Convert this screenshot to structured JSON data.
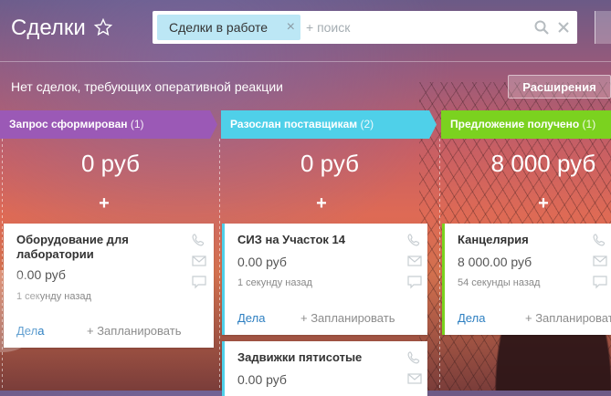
{
  "header": {
    "title": "Сделки",
    "filter_chip": "Сделки в работе",
    "chip_close": "×",
    "search_placeholder": "+ поиск"
  },
  "notice": "Нет сделок, требующих оперативной реакции",
  "extensions_button": "Расширения",
  "colors": {
    "stage1": "#9b59b6",
    "stage2": "#4fd0e9",
    "stage3": "#7bd21f",
    "link": "#2d7fc1"
  },
  "columns": [
    {
      "stage_name": "Запрос сформирован",
      "stage_count": "(1)",
      "sum": "0 руб",
      "add": "+",
      "cards": [
        {
          "title": "Оборудование для лаборатории",
          "amount": "0.00 руб",
          "time": "1 секунду назад",
          "link": "Дела",
          "plan": "+ Запланировать"
        }
      ]
    },
    {
      "stage_name": "Разослан поставщикам",
      "stage_count": "(2)",
      "sum": "0 руб",
      "add": "+",
      "cards": [
        {
          "title": "СИЗ на Участок 14",
          "amount": "0.00 руб",
          "time": "1 секунду назад",
          "link": "Дела",
          "plan": "+ Запланировать"
        },
        {
          "title": "Задвижки пятисотые",
          "amount": "0.00 руб"
        }
      ]
    },
    {
      "stage_name": "Предложение получено",
      "stage_count": "(1)",
      "sum": "8 000 руб",
      "add": "+",
      "cards": [
        {
          "title": "Канцелярия",
          "amount": "8 000.00 руб",
          "time": "54 секунды назад",
          "link": "Дела",
          "plan": "+ Запланировать"
        }
      ]
    }
  ]
}
